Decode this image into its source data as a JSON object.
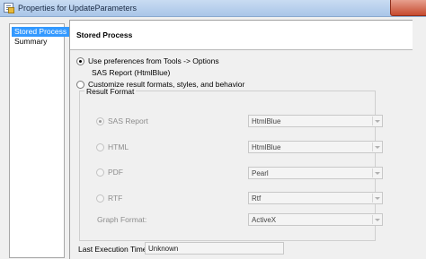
{
  "window": {
    "title": "Properties for UpdateParameters"
  },
  "nav": {
    "items": [
      "Stored Process",
      "Summary"
    ]
  },
  "panel": {
    "title": "Stored Process"
  },
  "options": {
    "use_preferences": "Use preferences from Tools -> Options",
    "preference_value": "SAS Report (HtmlBlue)",
    "customize": "Customize result formats, styles, and behavior"
  },
  "result_format": {
    "label": "Result Format",
    "rows": [
      {
        "format": "SAS Report",
        "style": "HtmlBlue",
        "checked": true
      },
      {
        "format": "HTML",
        "style": "HtmlBlue",
        "checked": false
      },
      {
        "format": "PDF",
        "style": "Pearl",
        "checked": false
      },
      {
        "format": "RTF",
        "style": "Rtf",
        "checked": false
      }
    ],
    "graph_format_label": "Graph Format:",
    "graph_format_value": "ActiveX"
  },
  "last_execution": {
    "label": "Last Execution Time:",
    "value": "Unknown"
  }
}
